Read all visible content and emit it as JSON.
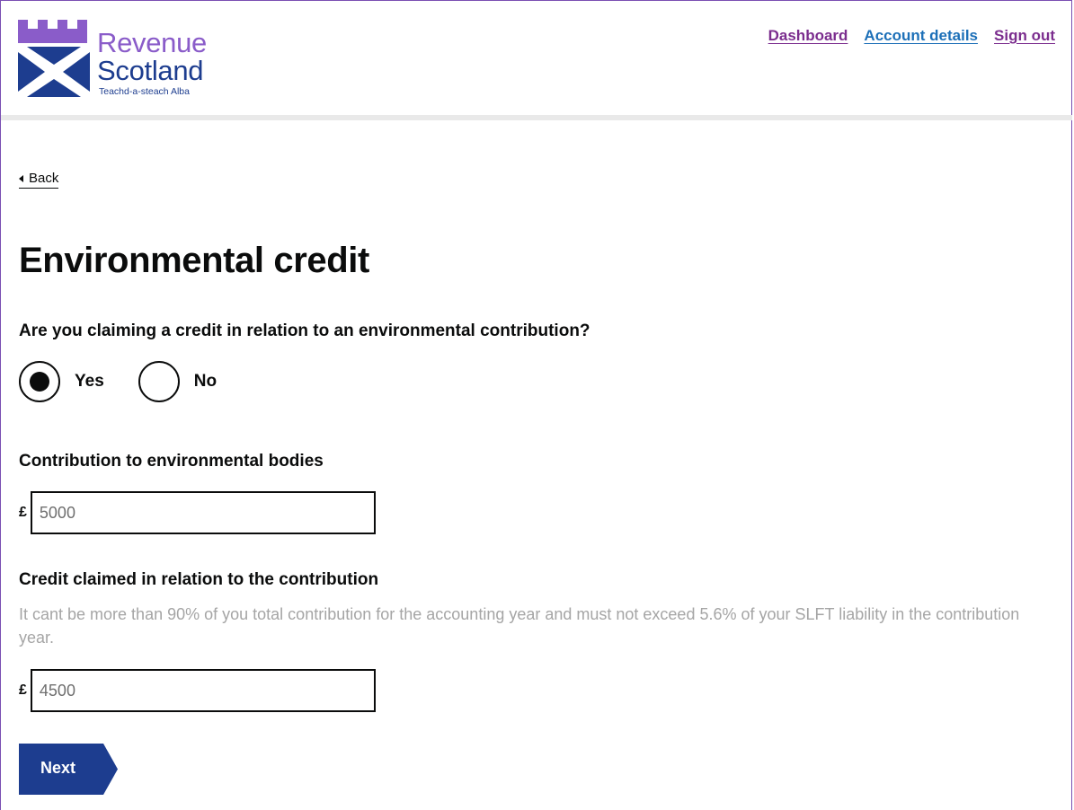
{
  "header": {
    "logo": {
      "line1": "Revenue",
      "line2": "Scotland",
      "tagline": "Teachd-a-steach Alba"
    },
    "nav": [
      {
        "label": "Dashboard",
        "state": "visited"
      },
      {
        "label": "Account details",
        "state": "link"
      },
      {
        "label": "Sign out",
        "state": "visited"
      }
    ]
  },
  "back_label": "Back",
  "page_title": "Environmental credit",
  "question": {
    "label": "Are you claiming a credit in relation to an environmental contribution?",
    "options": [
      {
        "label": "Yes",
        "selected": true
      },
      {
        "label": "No",
        "selected": false
      }
    ]
  },
  "contribution": {
    "label": "Contribution to environmental bodies",
    "currency": "£",
    "value": "5000"
  },
  "credit": {
    "label": "Credit claimed in relation to the contribution",
    "hint": "It cant be more than 90% of you total contribution for the accounting year and must not exceed 5.6% of your SLFT liability in the contribution year.",
    "currency": "£",
    "value": "4500"
  },
  "next_label": "Next",
  "colors": {
    "brand_purple": "#8a5cc9",
    "brand_blue": "#1d3d8f",
    "button_blue": "#1d3d8f",
    "visited_link": "#7b2d8e",
    "link": "#1d70b8"
  }
}
